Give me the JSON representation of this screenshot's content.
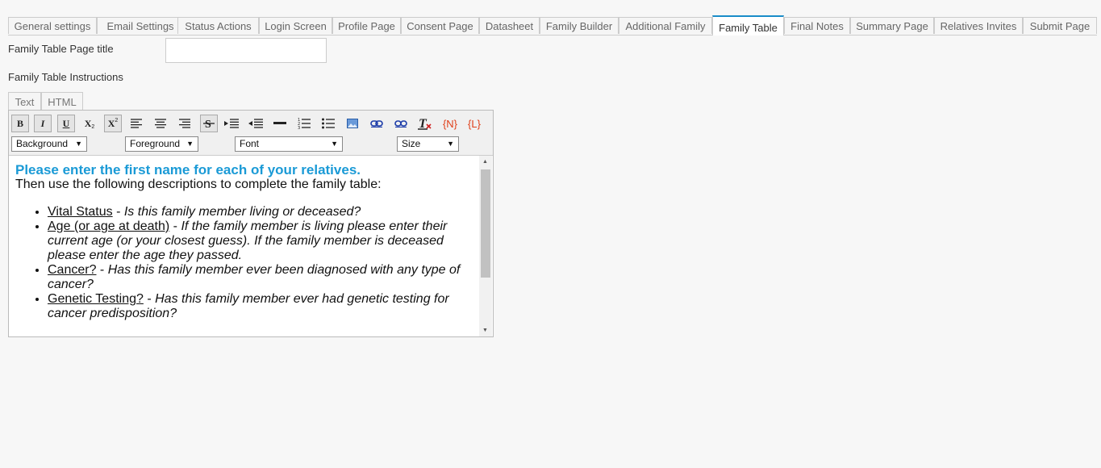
{
  "tabs": [
    {
      "label": "General settings",
      "active": false
    },
    {
      "label": "Email Settings",
      "active": false
    },
    {
      "label": "Status Actions",
      "active": false
    },
    {
      "label": "Login Screen",
      "active": false
    },
    {
      "label": "Profile Page",
      "active": false
    },
    {
      "label": "Consent Page",
      "active": false
    },
    {
      "label": "Datasheet",
      "active": false
    },
    {
      "label": "Family Builder",
      "active": false
    },
    {
      "label": "Additional Family",
      "active": false
    },
    {
      "label": "Family Table",
      "active": true
    },
    {
      "label": "Final Notes",
      "active": false
    },
    {
      "label": "Summary Page",
      "active": false
    },
    {
      "label": "Relatives Invites",
      "active": false
    },
    {
      "label": "Submit Page",
      "active": false
    }
  ],
  "form": {
    "title_label": "Family Table Page title",
    "title_value": "",
    "instructions_label": "Family Table Instructions"
  },
  "editor": {
    "modes": [
      "Text",
      "HTML"
    ],
    "toolbar": {
      "bold": "B",
      "italic": "I",
      "underline": "U",
      "subscript": "X",
      "superscript": "X",
      "name_token": "{N}",
      "link_token": "{L}"
    },
    "dropdowns": {
      "background": "Background",
      "foreground": "Foreground",
      "font": "Font",
      "size": "Size"
    },
    "content": {
      "heading": "Please enter the first name for each of your relatives.",
      "intro": "Then use the following descriptions to complete the family table:",
      "items": [
        {
          "term": "Vital Status",
          "desc": " - ",
          "desc_italic": "Is this family member living or deceased?"
        },
        {
          "term": "Age (or age at death)",
          "desc": " - ",
          "desc_italic": "If the family member is living please enter their current age (or your closest guess). If the family member is deceased please enter the age they passed."
        },
        {
          "term": "Cancer?",
          "desc": " - ",
          "desc_italic": "Has this family member ever been diagnosed with any type of cancer?"
        },
        {
          "term": "Genetic Testing?",
          "desc": " - ",
          "desc_italic": "Has this family member ever had genetic testing for cancer predisposition?"
        }
      ]
    }
  },
  "colors": {
    "accent": "#1a8cc9",
    "heading": "#1a9ad6",
    "token": "#e0401a"
  }
}
